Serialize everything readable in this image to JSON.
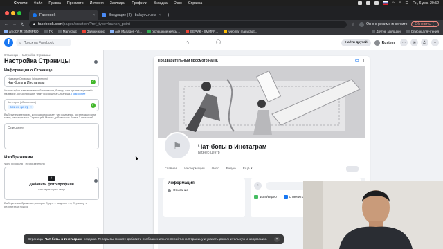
{
  "menubar": {
    "app": "Chrome",
    "items": [
      "Файл",
      "Правка",
      "Просмотр",
      "История",
      "Закладки",
      "Профили",
      "Вкладка",
      "Окно",
      "Справка"
    ],
    "clock": "Пн, 6 дек.  20:52"
  },
  "tabs": [
    {
      "label": "Facebook",
      "active": true
    },
    {
      "label": "Входящие (4) - balayev.rustam...",
      "active": false
    }
  ],
  "address": {
    "domain": "facebook.com",
    "path": "/pages/creation/?ref_type=launch_point"
  },
  "toolbar": {
    "incognito": "Окно в режиме инкогнито",
    "update": "Обновить"
  },
  "bookmarks": {
    "items": [
      "amoCRM: SMMPRO",
      "ГК",
      "Manychat",
      "Заявки курс",
      "Ads Manager - Vi...",
      "Успешные кейсы...",
      "БЕРИК - SMMPR...",
      "webinar manychat..."
    ],
    "right": [
      "Другие закладки",
      "Список для чтения"
    ]
  },
  "fb": {
    "search_placeholder": "Поиск на Facebook",
    "find_friends": "Найти друзей",
    "user": "Rustem"
  },
  "left": {
    "breadcrumb": "Страницы › Настройка Страницы",
    "title": "Настройка Страницы",
    "info_heading": "Информация о Странице",
    "name_label": "Название Страницы (обязательно)",
    "name_value": "Чат-боты в Инстаграм",
    "name_help": "Используйте название вашей компании, бренда или организации либо название, объясняющее, чему посвящена Страница.",
    "name_help_link": "Подробнее",
    "category_label": "Категория (обязательно)",
    "category_chip": "Бизнес-центр",
    "category_help": "Выберите категорию, которая описывает тип компании, организации или темы, связанные со Страницей. Можно добавить не более 3 категорий.",
    "description_placeholder": "Описание",
    "images_heading": "Изображения",
    "profile_photo_label": "Фото профиля · Необязательно",
    "add_photo": "Добавить фото профиля",
    "add_photo_sub": "или перетащите сюда",
    "photo_help": "Выберите изображение, которое будет ... выделит эту Страницу в результатах поиска"
  },
  "preview": {
    "heading": "Предварительный просмотр на ПК",
    "page_name": "Чат-боты в Инстаграм",
    "category": "Бизнес-центр",
    "tabs": [
      "Главная",
      "Информация",
      "Фото",
      "Видео",
      "Ещё ▾"
    ],
    "info_title": "Информация",
    "info_row": "Описание",
    "create_btn": "Создать публикацию",
    "photo_video": "Фото/видео",
    "check_in": "Отметиться"
  },
  "toast": {
    "prefix": "Страница",
    "page": "Чат-боты в Инстаграм",
    "text": "создана. Теперь вы можете добавить изображения или перейти на Страницу и указать дополнительную информацию."
  }
}
